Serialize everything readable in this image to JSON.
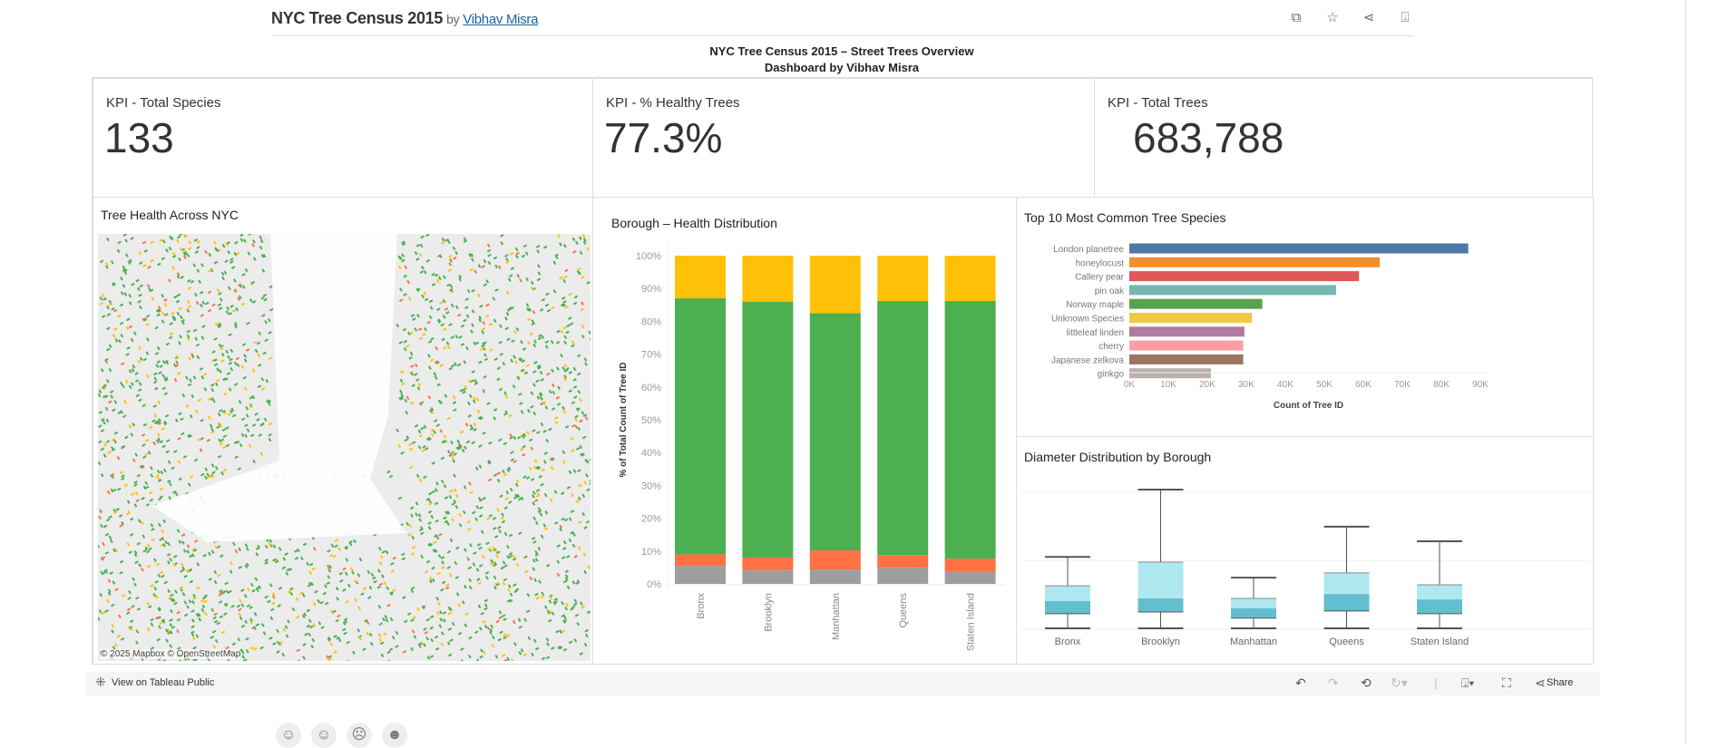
{
  "header": {
    "title": "NYC Tree Census 2015",
    "by": "by",
    "author": "Vibhav Misra",
    "icons": [
      "copy-icon",
      "star-icon",
      "share-icon",
      "download-icon"
    ]
  },
  "dashboard": {
    "title_line1": "NYC Tree Census 2015 – Street Trees Overview",
    "title_line2": "Dashboard by Vibhav Misra"
  },
  "kpis": [
    {
      "label": "KPI - Total Species",
      "value": "133"
    },
    {
      "label": "KPI - % Healthy Trees",
      "value": "77.3%"
    },
    {
      "label": "KPI - Total Trees",
      "value": "683,788"
    }
  ],
  "map": {
    "title": "Tree Health Across NYC",
    "credit": "© 2025 Mapbox  © OpenStreetMap",
    "colors": {
      "good": "#4caf50",
      "fair": "#ffc107",
      "poor": "#ff7043",
      "land": "#ececec",
      "water": "#ffffff"
    }
  },
  "chart_data": [
    {
      "type": "bar",
      "stacked": true,
      "title": "Borough – Health Distribution",
      "ylabel": "% of Total Count of Tree ID",
      "xlabel": "",
      "ylim": [
        0,
        100
      ],
      "yticks": [
        "0%",
        "10%",
        "20%",
        "30%",
        "40%",
        "50%",
        "60%",
        "70%",
        "80%",
        "90%",
        "100%"
      ],
      "categories": [
        "Bronx",
        "Brooklyn",
        "Manhattan",
        "Queens",
        "Staten Island"
      ],
      "series": [
        {
          "color": "#9e9e9e",
          "values": [
            5.5,
            4.2,
            4.4,
            5.0,
            3.7
          ]
        },
        {
          "color": "#ff7043",
          "values": [
            3.5,
            3.8,
            5.8,
            3.8,
            4.0
          ]
        },
        {
          "color": "#4caf50",
          "values": [
            78.0,
            78.0,
            72.3,
            77.4,
            78.5
          ]
        },
        {
          "color": "#ffc107",
          "values": [
            13.0,
            14.0,
            17.5,
            13.8,
            13.8
          ]
        }
      ]
    },
    {
      "type": "bar",
      "orientation": "horizontal",
      "title": "Top 10 Most Common Tree Species",
      "xlabel": "Count of Tree ID",
      "ylabel": "",
      "xlim": [
        0,
        90000
      ],
      "xticks": [
        "0K",
        "10K",
        "20K",
        "30K",
        "40K",
        "50K",
        "60K",
        "70K",
        "80K",
        "90K"
      ],
      "categories": [
        "London planetree",
        "honeylocust",
        "Callery pear",
        "pin oak",
        "Norway maple",
        "Unknown Species",
        "littleleaf linden",
        "cherry",
        "Japanese zelkova",
        "ginkgo"
      ],
      "values": [
        86900,
        64200,
        58900,
        53000,
        34100,
        31400,
        29500,
        29200,
        29200,
        20900
      ],
      "colors": [
        "#4e79a7",
        "#f28e2b",
        "#e15759",
        "#76b7b2",
        "#59a14f",
        "#edc948",
        "#b07aa1",
        "#ff9da7",
        "#9c755f",
        "#bab0ac"
      ]
    },
    {
      "type": "boxplot",
      "title": "Diameter Distribution by Borough",
      "ylim": [
        0,
        45
      ],
      "grid": true,
      "categories": [
        "Bronx",
        "Brooklyn",
        "Manhattan",
        "Queens",
        "Staten Island"
      ],
      "min": [
        0,
        0,
        0,
        0,
        0
      ],
      "q1": [
        4.3,
        4.8,
        3.0,
        5.1,
        4.3
      ],
      "median": [
        8.0,
        8.8,
        5.9,
        10.1,
        8.5
      ],
      "q3": [
        12.5,
        19.5,
        8.8,
        16.3,
        12.8
      ],
      "max": [
        21,
        40.8,
        14.9,
        29.9,
        25.6
      ],
      "colors": {
        "upper": "#b0e8f2",
        "lower": "#62bfd0"
      }
    }
  ],
  "toolbar": {
    "view_label": "View on Tableau Public",
    "share_label": "Share"
  },
  "footer": {
    "icons": [
      "face-icon-1",
      "face-icon-2",
      "face-icon-3",
      "face-icon-4"
    ]
  }
}
